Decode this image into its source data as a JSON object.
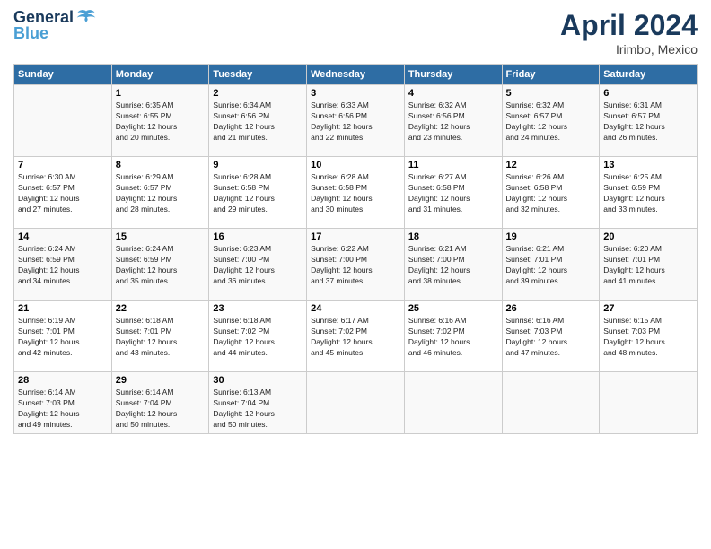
{
  "logo": {
    "line1": "General",
    "line2": "Blue"
  },
  "title": "April 2024",
  "location": "Irimbo, Mexico",
  "days_header": [
    "Sunday",
    "Monday",
    "Tuesday",
    "Wednesday",
    "Thursday",
    "Friday",
    "Saturday"
  ],
  "weeks": [
    [
      {
        "day": "",
        "info": ""
      },
      {
        "day": "1",
        "info": "Sunrise: 6:35 AM\nSunset: 6:55 PM\nDaylight: 12 hours\nand 20 minutes."
      },
      {
        "day": "2",
        "info": "Sunrise: 6:34 AM\nSunset: 6:56 PM\nDaylight: 12 hours\nand 21 minutes."
      },
      {
        "day": "3",
        "info": "Sunrise: 6:33 AM\nSunset: 6:56 PM\nDaylight: 12 hours\nand 22 minutes."
      },
      {
        "day": "4",
        "info": "Sunrise: 6:32 AM\nSunset: 6:56 PM\nDaylight: 12 hours\nand 23 minutes."
      },
      {
        "day": "5",
        "info": "Sunrise: 6:32 AM\nSunset: 6:57 PM\nDaylight: 12 hours\nand 24 minutes."
      },
      {
        "day": "6",
        "info": "Sunrise: 6:31 AM\nSunset: 6:57 PM\nDaylight: 12 hours\nand 26 minutes."
      }
    ],
    [
      {
        "day": "7",
        "info": "Sunrise: 6:30 AM\nSunset: 6:57 PM\nDaylight: 12 hours\nand 27 minutes."
      },
      {
        "day": "8",
        "info": "Sunrise: 6:29 AM\nSunset: 6:57 PM\nDaylight: 12 hours\nand 28 minutes."
      },
      {
        "day": "9",
        "info": "Sunrise: 6:28 AM\nSunset: 6:58 PM\nDaylight: 12 hours\nand 29 minutes."
      },
      {
        "day": "10",
        "info": "Sunrise: 6:28 AM\nSunset: 6:58 PM\nDaylight: 12 hours\nand 30 minutes."
      },
      {
        "day": "11",
        "info": "Sunrise: 6:27 AM\nSunset: 6:58 PM\nDaylight: 12 hours\nand 31 minutes."
      },
      {
        "day": "12",
        "info": "Sunrise: 6:26 AM\nSunset: 6:58 PM\nDaylight: 12 hours\nand 32 minutes."
      },
      {
        "day": "13",
        "info": "Sunrise: 6:25 AM\nSunset: 6:59 PM\nDaylight: 12 hours\nand 33 minutes."
      }
    ],
    [
      {
        "day": "14",
        "info": "Sunrise: 6:24 AM\nSunset: 6:59 PM\nDaylight: 12 hours\nand 34 minutes."
      },
      {
        "day": "15",
        "info": "Sunrise: 6:24 AM\nSunset: 6:59 PM\nDaylight: 12 hours\nand 35 minutes."
      },
      {
        "day": "16",
        "info": "Sunrise: 6:23 AM\nSunset: 7:00 PM\nDaylight: 12 hours\nand 36 minutes."
      },
      {
        "day": "17",
        "info": "Sunrise: 6:22 AM\nSunset: 7:00 PM\nDaylight: 12 hours\nand 37 minutes."
      },
      {
        "day": "18",
        "info": "Sunrise: 6:21 AM\nSunset: 7:00 PM\nDaylight: 12 hours\nand 38 minutes."
      },
      {
        "day": "19",
        "info": "Sunrise: 6:21 AM\nSunset: 7:01 PM\nDaylight: 12 hours\nand 39 minutes."
      },
      {
        "day": "20",
        "info": "Sunrise: 6:20 AM\nSunset: 7:01 PM\nDaylight: 12 hours\nand 41 minutes."
      }
    ],
    [
      {
        "day": "21",
        "info": "Sunrise: 6:19 AM\nSunset: 7:01 PM\nDaylight: 12 hours\nand 42 minutes."
      },
      {
        "day": "22",
        "info": "Sunrise: 6:18 AM\nSunset: 7:01 PM\nDaylight: 12 hours\nand 43 minutes."
      },
      {
        "day": "23",
        "info": "Sunrise: 6:18 AM\nSunset: 7:02 PM\nDaylight: 12 hours\nand 44 minutes."
      },
      {
        "day": "24",
        "info": "Sunrise: 6:17 AM\nSunset: 7:02 PM\nDaylight: 12 hours\nand 45 minutes."
      },
      {
        "day": "25",
        "info": "Sunrise: 6:16 AM\nSunset: 7:02 PM\nDaylight: 12 hours\nand 46 minutes."
      },
      {
        "day": "26",
        "info": "Sunrise: 6:16 AM\nSunset: 7:03 PM\nDaylight: 12 hours\nand 47 minutes."
      },
      {
        "day": "27",
        "info": "Sunrise: 6:15 AM\nSunset: 7:03 PM\nDaylight: 12 hours\nand 48 minutes."
      }
    ],
    [
      {
        "day": "28",
        "info": "Sunrise: 6:14 AM\nSunset: 7:03 PM\nDaylight: 12 hours\nand 49 minutes."
      },
      {
        "day": "29",
        "info": "Sunrise: 6:14 AM\nSunset: 7:04 PM\nDaylight: 12 hours\nand 50 minutes."
      },
      {
        "day": "30",
        "info": "Sunrise: 6:13 AM\nSunset: 7:04 PM\nDaylight: 12 hours\nand 50 minutes."
      },
      {
        "day": "",
        "info": ""
      },
      {
        "day": "",
        "info": ""
      },
      {
        "day": "",
        "info": ""
      },
      {
        "day": "",
        "info": ""
      }
    ]
  ]
}
